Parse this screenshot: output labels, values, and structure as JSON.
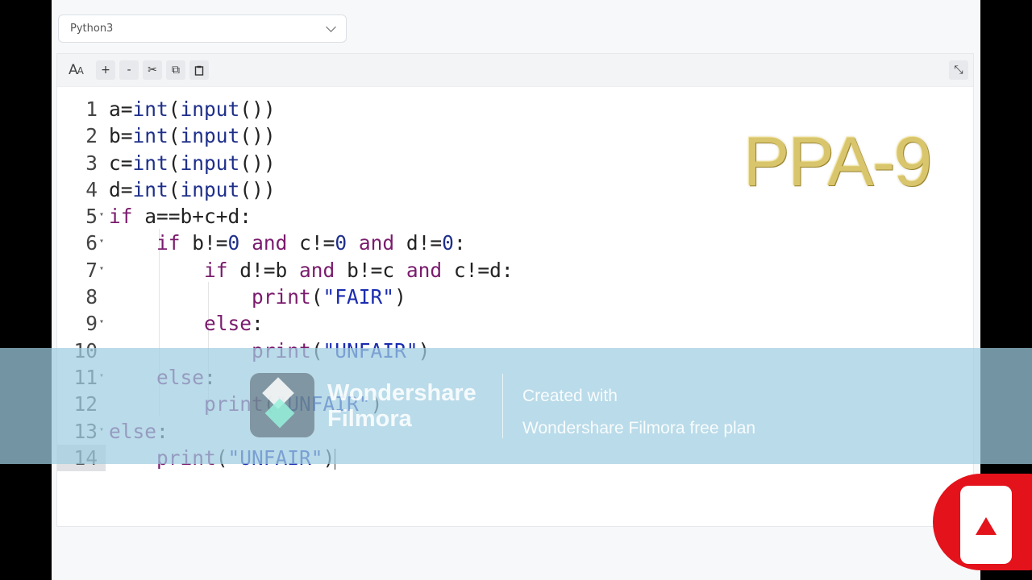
{
  "language_select": {
    "value": "Python3"
  },
  "toolbar": {
    "font_big": "A",
    "font_small": "A",
    "zoom_in": "+",
    "zoom_out": "-",
    "cut": "✂",
    "copy": "⧉",
    "paste": "📋",
    "collapse": "⤡"
  },
  "editor": {
    "lines": [
      {
        "n": "1",
        "fold": ""
      },
      {
        "n": "2",
        "fold": ""
      },
      {
        "n": "3",
        "fold": ""
      },
      {
        "n": "4",
        "fold": ""
      },
      {
        "n": "5",
        "fold": "▾"
      },
      {
        "n": "6",
        "fold": "▾"
      },
      {
        "n": "7",
        "fold": "▾"
      },
      {
        "n": "8",
        "fold": ""
      },
      {
        "n": "9",
        "fold": "▾"
      },
      {
        "n": "10",
        "fold": ""
      },
      {
        "n": "11",
        "fold": "▾"
      },
      {
        "n": "12",
        "fold": ""
      },
      {
        "n": "13",
        "fold": "▾"
      },
      {
        "n": "14",
        "fold": ""
      }
    ],
    "code": {
      "l1": "a=int(input())",
      "l2": "b=int(input())",
      "l3": "c=int(input())",
      "l4": "d=int(input())",
      "l5": "if a==b+c+d:",
      "l6": "    if b!=0 and c!=0 and d!=0:",
      "l7": "        if d!=b and b!=c and c!=d:",
      "l8": "            print(\"FAIR\")",
      "l9": "        else:",
      "l10": "            print(\"UNFAIR\")",
      "l11": "    else:",
      "l12": "        print(\"UNFAIR\")",
      "l13": "else:",
      "l14": "    print(\"UNFAIR\")"
    }
  },
  "overlay_title": "PPA-9",
  "watermark": {
    "brand_line1": "Wondershare",
    "brand_line2": "Filmora",
    "created_line1": "Created with",
    "created_line2": "Wondershare Filmora free plan"
  }
}
